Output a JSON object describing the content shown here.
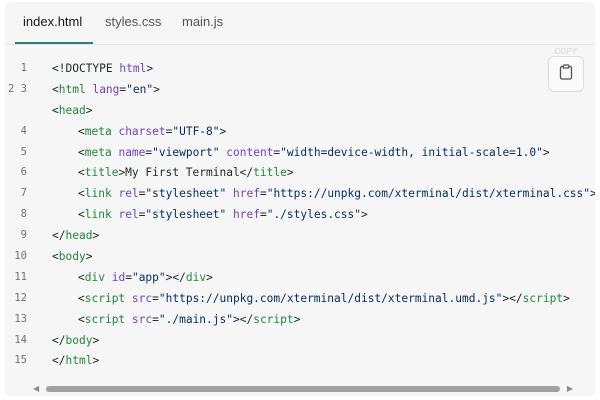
{
  "tabs": [
    {
      "label": "index.html",
      "active": true
    },
    {
      "label": "styles.css",
      "active": false
    },
    {
      "label": "main.js",
      "active": false
    }
  ],
  "copy_button": {
    "icon": "clipboard-icon",
    "faint_label": "COPY"
  },
  "code": {
    "language": "html",
    "lines": [
      {
        "num": "1",
        "indent": 0,
        "tokens": [
          {
            "t": "p",
            "v": "<!DOCTYPE "
          },
          {
            "t": "a",
            "v": "html"
          },
          {
            "t": "p",
            "v": ">"
          }
        ]
      },
      {
        "num": "2 3",
        "indent": 0,
        "tokens": [
          {
            "t": "p",
            "v": "<"
          },
          {
            "t": "t",
            "v": "html"
          },
          {
            "t": "p",
            "v": " "
          },
          {
            "t": "a",
            "v": "lang"
          },
          {
            "t": "p",
            "v": "="
          },
          {
            "t": "s",
            "v": "\"en\""
          },
          {
            "t": "p",
            "v": ">"
          }
        ]
      },
      {
        "num": "",
        "indent": 0,
        "tokens": [
          {
            "t": "p",
            "v": "<"
          },
          {
            "t": "t",
            "v": "head"
          },
          {
            "t": "p",
            "v": ">"
          }
        ]
      },
      {
        "num": "4",
        "indent": 1,
        "tokens": [
          {
            "t": "p",
            "v": "<"
          },
          {
            "t": "t",
            "v": "meta"
          },
          {
            "t": "p",
            "v": " "
          },
          {
            "t": "a",
            "v": "charset"
          },
          {
            "t": "p",
            "v": "="
          },
          {
            "t": "s",
            "v": "\"UTF-8\""
          },
          {
            "t": "p",
            "v": ">"
          }
        ]
      },
      {
        "num": "5",
        "indent": 1,
        "tokens": [
          {
            "t": "p",
            "v": "<"
          },
          {
            "t": "t",
            "v": "meta"
          },
          {
            "t": "p",
            "v": " "
          },
          {
            "t": "a",
            "v": "name"
          },
          {
            "t": "p",
            "v": "="
          },
          {
            "t": "s",
            "v": "\"viewport\""
          },
          {
            "t": "p",
            "v": " "
          },
          {
            "t": "a",
            "v": "content"
          },
          {
            "t": "p",
            "v": "="
          },
          {
            "t": "s",
            "v": "\"width=device-width, initial-scale=1.0\""
          },
          {
            "t": "p",
            "v": ">"
          }
        ]
      },
      {
        "num": "6",
        "indent": 1,
        "tokens": [
          {
            "t": "p",
            "v": "<"
          },
          {
            "t": "t",
            "v": "title"
          },
          {
            "t": "p",
            "v": ">My First Terminal</"
          },
          {
            "t": "t",
            "v": "title"
          },
          {
            "t": "p",
            "v": ">"
          }
        ]
      },
      {
        "num": "7",
        "indent": 1,
        "tokens": [
          {
            "t": "p",
            "v": "<"
          },
          {
            "t": "t",
            "v": "link"
          },
          {
            "t": "p",
            "v": " "
          },
          {
            "t": "a",
            "v": "rel"
          },
          {
            "t": "p",
            "v": "="
          },
          {
            "t": "s",
            "v": "\"stylesheet\""
          },
          {
            "t": "p",
            "v": " "
          },
          {
            "t": "a",
            "v": "href"
          },
          {
            "t": "p",
            "v": "="
          },
          {
            "t": "s",
            "v": "\"https://unpkg.com/xterminal/dist/xterminal.css\""
          },
          {
            "t": "p",
            "v": ">"
          }
        ]
      },
      {
        "num": "8",
        "indent": 1,
        "tokens": [
          {
            "t": "p",
            "v": "<"
          },
          {
            "t": "t",
            "v": "link"
          },
          {
            "t": "p",
            "v": " "
          },
          {
            "t": "a",
            "v": "rel"
          },
          {
            "t": "p",
            "v": "="
          },
          {
            "t": "s",
            "v": "\"stylesheet\""
          },
          {
            "t": "p",
            "v": " "
          },
          {
            "t": "a",
            "v": "href"
          },
          {
            "t": "p",
            "v": "="
          },
          {
            "t": "s",
            "v": "\"./styles.css\""
          },
          {
            "t": "p",
            "v": ">"
          }
        ]
      },
      {
        "num": "9",
        "indent": 0,
        "tokens": [
          {
            "t": "p",
            "v": "</"
          },
          {
            "t": "t",
            "v": "head"
          },
          {
            "t": "p",
            "v": ">"
          }
        ]
      },
      {
        "num": "10",
        "indent": 0,
        "tokens": [
          {
            "t": "p",
            "v": "<"
          },
          {
            "t": "t",
            "v": "body"
          },
          {
            "t": "p",
            "v": ">"
          }
        ]
      },
      {
        "num": "11",
        "indent": 1,
        "tokens": [
          {
            "t": "p",
            "v": "<"
          },
          {
            "t": "t",
            "v": "div"
          },
          {
            "t": "p",
            "v": " "
          },
          {
            "t": "a",
            "v": "id"
          },
          {
            "t": "p",
            "v": "="
          },
          {
            "t": "s",
            "v": "\"app\""
          },
          {
            "t": "p",
            "v": "></"
          },
          {
            "t": "t",
            "v": "div"
          },
          {
            "t": "p",
            "v": ">"
          }
        ]
      },
      {
        "num": "12",
        "indent": 1,
        "tokens": [
          {
            "t": "p",
            "v": "<"
          },
          {
            "t": "t",
            "v": "script"
          },
          {
            "t": "p",
            "v": " "
          },
          {
            "t": "a",
            "v": "src"
          },
          {
            "t": "p",
            "v": "="
          },
          {
            "t": "s",
            "v": "\"https://unpkg.com/xterminal/dist/xterminal.umd.js\""
          },
          {
            "t": "p",
            "v": "></"
          },
          {
            "t": "t",
            "v": "script"
          },
          {
            "t": "p",
            "v": ">"
          }
        ]
      },
      {
        "num": "13",
        "indent": 1,
        "tokens": [
          {
            "t": "p",
            "v": "<"
          },
          {
            "t": "t",
            "v": "script"
          },
          {
            "t": "p",
            "v": " "
          },
          {
            "t": "a",
            "v": "src"
          },
          {
            "t": "p",
            "v": "="
          },
          {
            "t": "s",
            "v": "\"./main.js\""
          },
          {
            "t": "p",
            "v": "></"
          },
          {
            "t": "t",
            "v": "script"
          },
          {
            "t": "p",
            "v": ">"
          }
        ]
      },
      {
        "num": "14",
        "indent": 0,
        "tokens": [
          {
            "t": "p",
            "v": "</"
          },
          {
            "t": "t",
            "v": "body"
          },
          {
            "t": "p",
            "v": ">"
          }
        ]
      },
      {
        "num": "15",
        "indent": 0,
        "tokens": [
          {
            "t": "p",
            "v": "</"
          },
          {
            "t": "t",
            "v": "html"
          },
          {
            "t": "p",
            "v": ">"
          }
        ]
      }
    ]
  },
  "scrollbar": {
    "left_arrow": "◀",
    "right_arrow": "▶",
    "orientation": "horizontal"
  },
  "colors": {
    "tag": "#22863a",
    "attribute": "#6f42c1",
    "string": "#032f62",
    "active_tab_underline": "#2f7d73"
  }
}
